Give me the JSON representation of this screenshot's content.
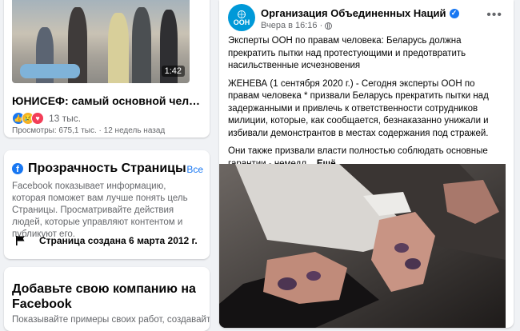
{
  "video": {
    "duration": "1:42",
    "title": "ЮНИСЕФ: самый основной человечес...",
    "reaction_count": "13 тыс.",
    "views": "Просмотры: 675,1 тыс. · 12 недель назад"
  },
  "transparency": {
    "title": "Прозрачность Страницы",
    "see_all": "Все",
    "description": "Facebook показывает информацию, которая поможет вам лучше понять цель Страницы. Просматривайте действия людей, которые управляют контентом и публикуют его.",
    "created": "Страница создана 6 марта 2012 г."
  },
  "business": {
    "title": "Добавьте свою компанию на Facebook",
    "description": "Показывайте примеры своих работ, создавайте"
  },
  "post": {
    "avatar_text": "ООН",
    "page_name": "Организация Объединенных Наций",
    "time": "Вчера в 16:16 ·",
    "headline": "Эксперты ООН по правам человека: Беларусь должна прекратить пытки над протестующими и предотвратить насильственные исчезновения",
    "body": "ЖЕНЕВА (1 сентября 2020 г.) - Сегодня эксперты ООН по правам человека * призвали Беларусь прекратить пытки над задержанными и привлечь к ответственности сотрудников милиции, которые, как сообщается, безнаказанно унижали и избивали демонстрантов в местах содержания под стражей.",
    "body2": "Они также призвали власти полностью соблюдать основные гарантии - немедл...",
    "see_more": "Ещё"
  },
  "colors": {
    "background": "#f0f2f5",
    "facebook_blue": "#1877f2",
    "un_blue": "#0099d8",
    "secondary_text": "#65676b"
  },
  "icons": {
    "like": "like-reaction-icon",
    "sad": "sad-reaction-icon",
    "love": "love-reaction-icon",
    "facebook": "facebook-icon",
    "flag": "flag-icon",
    "verified": "verified-badge-icon",
    "globe": "globe-icon",
    "more": "more-options-icon"
  }
}
